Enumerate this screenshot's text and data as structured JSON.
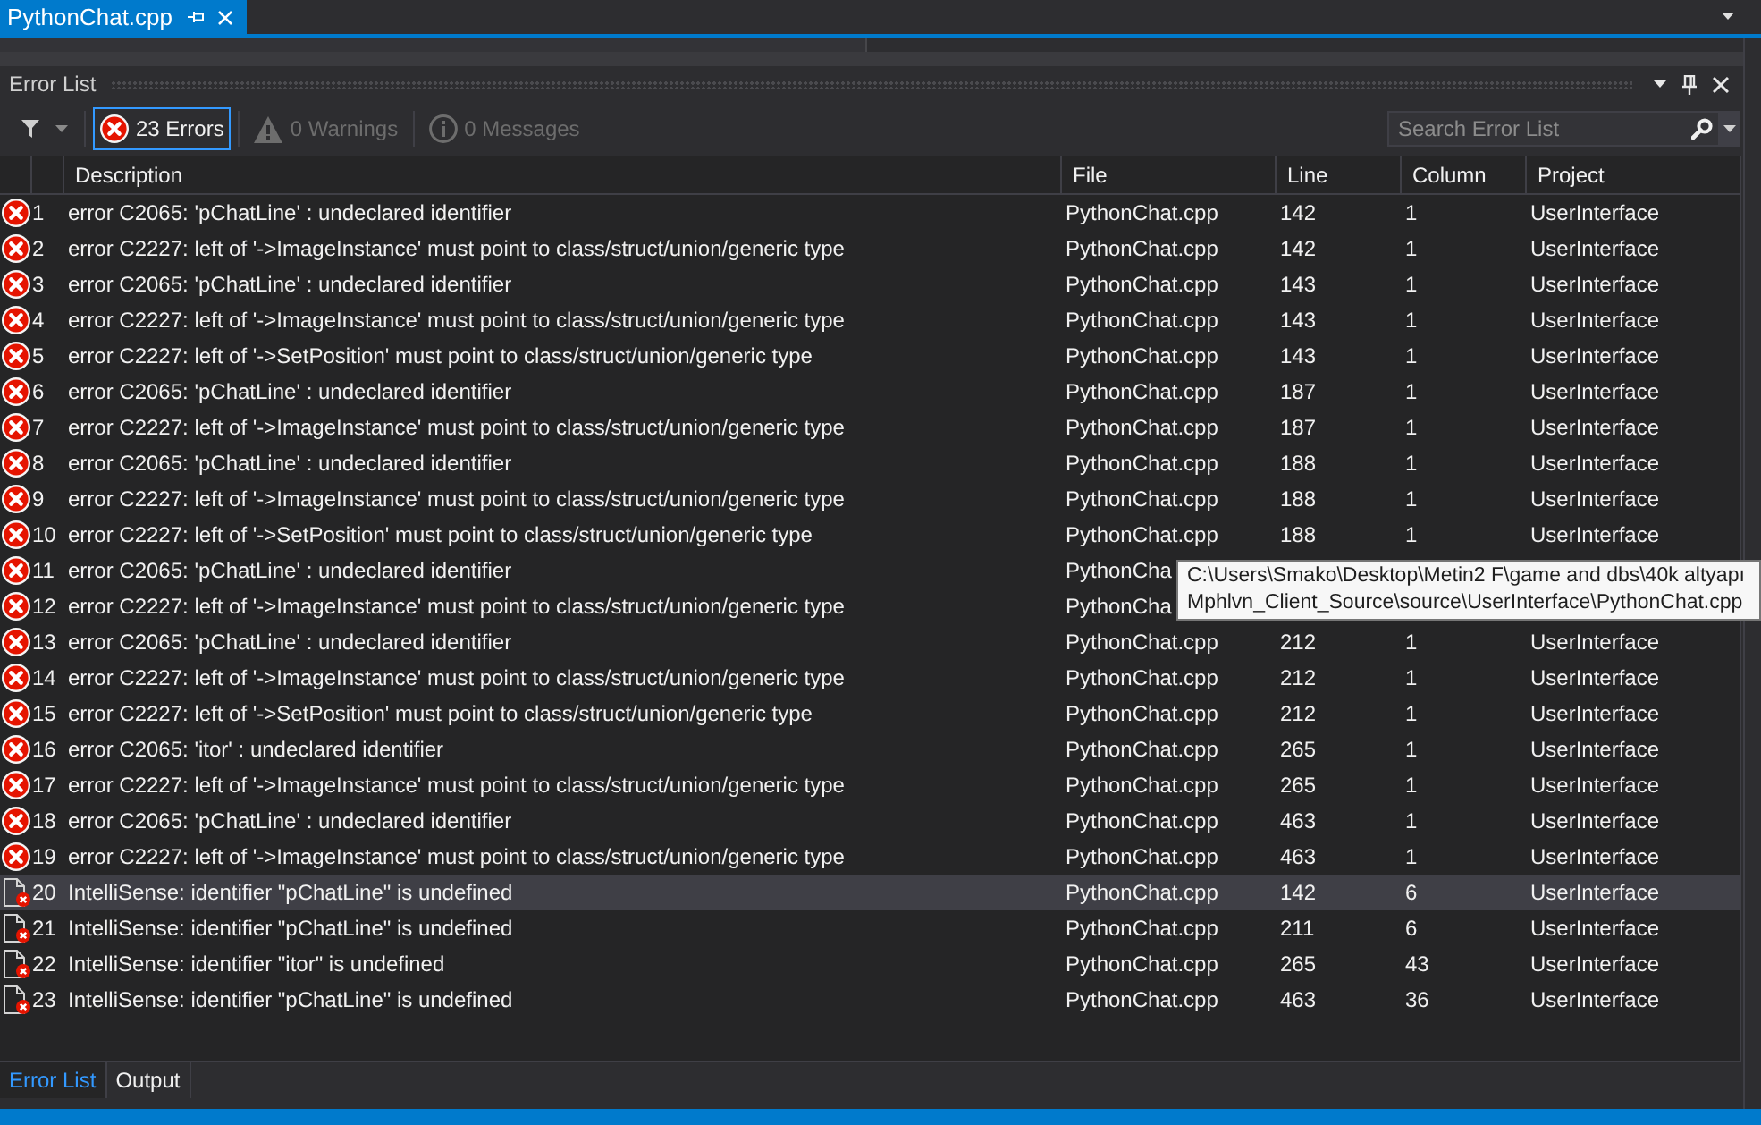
{
  "document_tabs": [
    {
      "label": "PythonChat.cpp",
      "selected": true
    }
  ],
  "panel": {
    "title": "Error List"
  },
  "toolbar": {
    "filters": [
      {
        "kind": "error",
        "label": "23 Errors",
        "selected": true,
        "disabled": false
      },
      {
        "kind": "warning",
        "label": "0 Warnings",
        "selected": false,
        "disabled": true
      },
      {
        "kind": "message",
        "label": "0 Messages",
        "selected": false,
        "disabled": true
      }
    ],
    "search": {
      "placeholder": "Search Error List"
    }
  },
  "table": {
    "columns": [
      "Description",
      "File",
      "Line",
      "Column",
      "Project"
    ],
    "rows": [
      {
        "kind": "error",
        "number": "1",
        "description": "error C2065: 'pChatLine' : undeclared identifier",
        "file": "PythonChat.cpp",
        "line": "142",
        "column": "1",
        "project": "UserInterface",
        "selected": false
      },
      {
        "kind": "error",
        "number": "2",
        "description": "error C2227: left of '->ImageInstance' must point to class/struct/union/generic type",
        "file": "PythonChat.cpp",
        "line": "142",
        "column": "1",
        "project": "UserInterface",
        "selected": false
      },
      {
        "kind": "error",
        "number": "3",
        "description": "error C2065: 'pChatLine' : undeclared identifier",
        "file": "PythonChat.cpp",
        "line": "143",
        "column": "1",
        "project": "UserInterface",
        "selected": false
      },
      {
        "kind": "error",
        "number": "4",
        "description": "error C2227: left of '->ImageInstance' must point to class/struct/union/generic type",
        "file": "PythonChat.cpp",
        "line": "143",
        "column": "1",
        "project": "UserInterface",
        "selected": false
      },
      {
        "kind": "error",
        "number": "5",
        "description": "error C2227: left of '->SetPosition' must point to class/struct/union/generic type",
        "file": "PythonChat.cpp",
        "line": "143",
        "column": "1",
        "project": "UserInterface",
        "selected": false
      },
      {
        "kind": "error",
        "number": "6",
        "description": "error C2065: 'pChatLine' : undeclared identifier",
        "file": "PythonChat.cpp",
        "line": "187",
        "column": "1",
        "project": "UserInterface",
        "selected": false
      },
      {
        "kind": "error",
        "number": "7",
        "description": "error C2227: left of '->ImageInstance' must point to class/struct/union/generic type",
        "file": "PythonChat.cpp",
        "line": "187",
        "column": "1",
        "project": "UserInterface",
        "selected": false
      },
      {
        "kind": "error",
        "number": "8",
        "description": "error C2065: 'pChatLine' : undeclared identifier",
        "file": "PythonChat.cpp",
        "line": "188",
        "column": "1",
        "project": "UserInterface",
        "selected": false
      },
      {
        "kind": "error",
        "number": "9",
        "description": "error C2227: left of '->ImageInstance' must point to class/struct/union/generic type",
        "file": "PythonChat.cpp",
        "line": "188",
        "column": "1",
        "project": "UserInterface",
        "selected": false
      },
      {
        "kind": "error",
        "number": "10",
        "description": "error C2227: left of '->SetPosition' must point to class/struct/union/generic type",
        "file": "PythonChat.cpp",
        "line": "188",
        "column": "1",
        "project": "UserInterface",
        "selected": false
      },
      {
        "kind": "error",
        "number": "11",
        "description": "error C2065: 'pChatLine' : undeclared identifier",
        "file": "PythonCha",
        "selected": false
      },
      {
        "kind": "error",
        "number": "12",
        "description": "error C2227: left of '->ImageInstance' must point to class/struct/union/generic type",
        "file": "PythonCha",
        "selected": false
      },
      {
        "kind": "error",
        "number": "13",
        "description": "error C2065: 'pChatLine' : undeclared identifier",
        "file": "PythonChat.cpp",
        "line": "212",
        "column": "1",
        "project": "UserInterface",
        "selected": false
      },
      {
        "kind": "error",
        "number": "14",
        "description": "error C2227: left of '->ImageInstance' must point to class/struct/union/generic type",
        "file": "PythonChat.cpp",
        "line": "212",
        "column": "1",
        "project": "UserInterface",
        "selected": false
      },
      {
        "kind": "error",
        "number": "15",
        "description": "error C2227: left of '->SetPosition' must point to class/struct/union/generic type",
        "file": "PythonChat.cpp",
        "line": "212",
        "column": "1",
        "project": "UserInterface",
        "selected": false
      },
      {
        "kind": "error",
        "number": "16",
        "description": "error C2065: 'itor' : undeclared identifier",
        "file": "PythonChat.cpp",
        "line": "265",
        "column": "1",
        "project": "UserInterface",
        "selected": false
      },
      {
        "kind": "error",
        "number": "17",
        "description": "error C2227: left of '->ImageInstance' must point to class/struct/union/generic type",
        "file": "PythonChat.cpp",
        "line": "265",
        "column": "1",
        "project": "UserInterface",
        "selected": false
      },
      {
        "kind": "error",
        "number": "18",
        "description": "error C2065: 'pChatLine' : undeclared identifier",
        "file": "PythonChat.cpp",
        "line": "463",
        "column": "1",
        "project": "UserInterface",
        "selected": false
      },
      {
        "kind": "error",
        "number": "19",
        "description": "error C2227: left of '->ImageInstance' must point to class/struct/union/generic type",
        "file": "PythonChat.cpp",
        "line": "463",
        "column": "1",
        "project": "UserInterface",
        "selected": false
      },
      {
        "kind": "intellisense",
        "number": "20",
        "description": "IntelliSense: identifier \"pChatLine\" is undefined",
        "file": "PythonChat.cpp",
        "line": "142",
        "column": "6",
        "project": "UserInterface",
        "selected": true
      },
      {
        "kind": "intellisense",
        "number": "21",
        "description": "IntelliSense: identifier \"pChatLine\" is undefined",
        "file": "PythonChat.cpp",
        "line": "211",
        "column": "6",
        "project": "UserInterface",
        "selected": false
      },
      {
        "kind": "intellisense",
        "number": "22",
        "description": "IntelliSense: identifier \"itor\" is undefined",
        "file": "PythonChat.cpp",
        "line": "265",
        "column": "43",
        "project": "UserInterface",
        "selected": false
      },
      {
        "kind": "intellisense",
        "number": "23",
        "description": "IntelliSense: identifier \"pChatLine\" is undefined",
        "file": "PythonChat.cpp",
        "line": "463",
        "column": "36",
        "project": "UserInterface",
        "selected": false
      }
    ]
  },
  "tooltip": {
    "lines": [
      "C:\\Users\\Smako\\Desktop\\Metin2 F\\game and dbs\\40k altyapı",
      "Mphlvn_Client_Source\\source\\UserInterface\\PythonChat.cpp"
    ]
  },
  "bottom_tabs": [
    {
      "label": "Error List",
      "selected": true
    },
    {
      "label": "Output",
      "selected": false
    }
  ]
}
